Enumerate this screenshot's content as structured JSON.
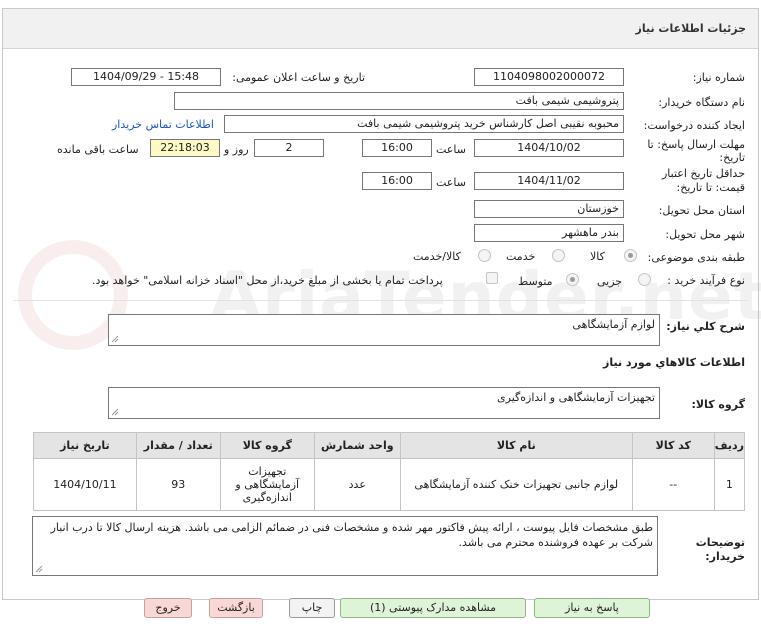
{
  "page_title": "جزئیات اطلاعات نیاز",
  "fields": {
    "need_number_label": "شماره نیاز:",
    "need_number": "1104098002000072",
    "announce_label": "تاریخ و ساعت اعلان عمومی:",
    "announce_value": "1404/09/29 - 15:48",
    "buyer_org_label": "نام دستگاه خریدار:",
    "buyer_org": "پتروشیمی شیمی بافت",
    "creator_label": "ایجاد کننده درخواست:",
    "creator": "محبوبه نقیبی اصل کارشناس خرید پتروشیمی شیمی بافت",
    "contact_link": "اطلاعات تماس خریدار",
    "deadline_label_1": "مهلت ارسال پاسخ: تا",
    "deadline_label_2": "تاریخ:",
    "deadline_date": "1404/10/02",
    "time_label": "ساعت",
    "deadline_time": "16:00",
    "days_value": "2",
    "days_label": "روز و",
    "remaining_time": "22:18:03",
    "remaining_label": "ساعت باقی مانده",
    "validity_label_1": "حداقل تاریخ اعتبار",
    "validity_label_2": "قیمت: تا تاریخ:",
    "validity_date": "1404/11/02",
    "validity_time_label": "ساعت",
    "validity_time": "16:00",
    "province_label": "استان محل تحویل:",
    "province": "خوزستان",
    "city_label": "شهر محل تحویل:",
    "city": "بندر ماهشهر",
    "category_label": "طبقه بندی موضوعی:",
    "category_options": [
      "کالا",
      "خدمت",
      "کالا/خدمت"
    ],
    "process_label": "نوع فرآیند خرید :",
    "process_options": [
      "جزیی",
      "متوسط"
    ],
    "payment_note": "پرداخت تمام یا بخشی از مبلغ خرید،از محل \"اسناد خزانه اسلامی\" خواهد بود."
  },
  "summary_label": "شرح کلي نياز:",
  "summary_value": "لوازم آزمایشگاهی",
  "goods_info_title": "اطلاعات کالاهاي مورد نياز",
  "goods_group_label": "گروه کالا:",
  "goods_group_value": "تجهیزات آزمایشگاهی و اندازه‌گیری",
  "table": {
    "headers": [
      "ردیف",
      "کد کالا",
      "نام کالا",
      "واحد شمارش",
      "گروه کالا",
      "تعداد / مقدار",
      "تاریخ نیاز"
    ],
    "rows": [
      {
        "row": "1",
        "code": "--",
        "name": "لوازم جانبی تجهیزات خنک کننده آزمایشگاهی",
        "unit": "عدد",
        "group": "تجهیزات آزمایشگاهی و اندازه‌گیری",
        "qty": "93",
        "date": "1404/10/11"
      }
    ]
  },
  "buyer_notes_label_1": "توضیحات",
  "buyer_notes_label_2": "خریدار:",
  "buyer_notes": "طبق مشخصات فایل پیوست ، ارائه پیش فاکتور مهر شده و مشخصات فنی در ضمائم الزامی می باشد. هزینه ارسال کالا تا درب انبار شرکت بر عهده فروشنده محترم می باشد.",
  "buttons": {
    "reply": "پاسخ به نیاز",
    "attachments": "مشاهده مدارک پیوستی (1)",
    "print": "چاپ",
    "back": "بازگشت",
    "exit": "خروج"
  },
  "colors": {
    "link": "#1a56c4",
    "header_bg": "#e4e4e4",
    "remaining_bg": "#fdf9c4",
    "reply_btn": "#dff3d6",
    "back_btn": "#fad7d7"
  }
}
